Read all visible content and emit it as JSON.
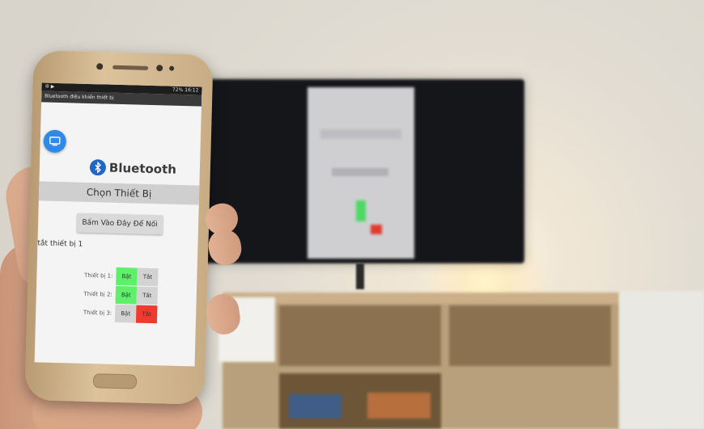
{
  "phone_app": {
    "status_bar": {
      "left": "⚙ ▶",
      "right": "72% 16:12"
    },
    "app_title": "Bluetooth điều khiển thiết bị",
    "logo_text": "Bluetooth",
    "section_title": "Chọn Thiết Bị",
    "connect_button": "Bấm Vào Đây Để Nối",
    "status_message": "tắt thiết bị 1",
    "devices": [
      {
        "label": "Thiết bị 1:",
        "on": "Bật",
        "off": "Tắt",
        "state": "on"
      },
      {
        "label": "Thiết bị 2:",
        "on": "Bật",
        "off": "Tắt",
        "state": "on"
      },
      {
        "label": "Thiết bị 3:",
        "on": "Bật",
        "off": "Tắt",
        "state": "off"
      }
    ]
  },
  "colors": {
    "on_active": "#5ef06a",
    "off_active": "#ef3b2f",
    "inactive": "#d3d3d3",
    "fab": "#2e8ae6"
  }
}
